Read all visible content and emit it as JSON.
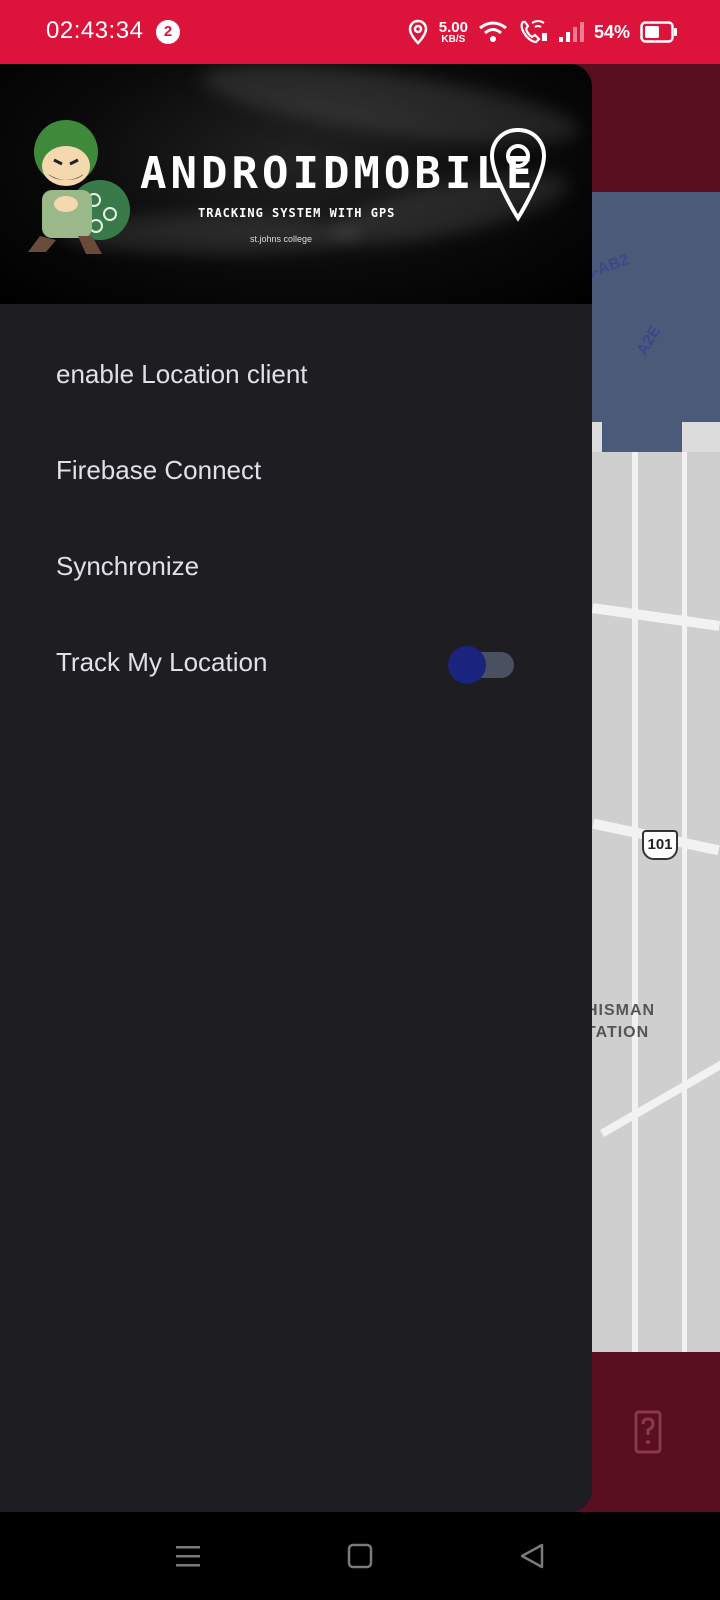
{
  "status_bar": {
    "time": "02:43:34",
    "notification_count": "2",
    "net_speed_value": "5.00",
    "net_speed_unit": "KB/S",
    "battery_percent": "54%",
    "icons": [
      "location-icon",
      "wifi-icon",
      "wifi-call-icon",
      "signal-icon",
      "battery-icon"
    ]
  },
  "drawer": {
    "header": {
      "title": "ANDROIDMOBILE",
      "subtitle": "TRACKING SYSTEM WITH GPS",
      "college": "st.johns college"
    },
    "items": [
      {
        "label": "enable Location client"
      },
      {
        "label": "Firebase Connect"
      },
      {
        "label": "Synchronize"
      },
      {
        "label": "Track My Location",
        "switch": true,
        "switch_on": false
      }
    ]
  },
  "map": {
    "labels": [
      "I-AB2",
      "A2E",
      "HISMAN",
      "TATION"
    ],
    "highway_shield": "101"
  },
  "colors": {
    "status_bar": "#dc143c",
    "app_bar": "#5a0f20",
    "drawer_bg": "#1e1d22",
    "switch_thumb": "#1a237e"
  }
}
